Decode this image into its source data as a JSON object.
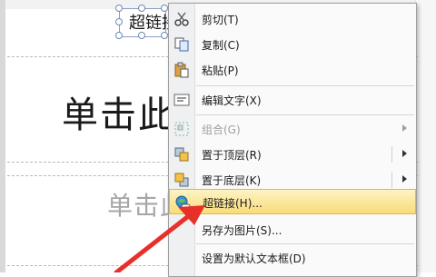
{
  "slide": {
    "hyperlink_textbox": "超链接",
    "title_placeholder": "单击此",
    "subtitle_placeholder": "单击此"
  },
  "context_menu": {
    "items": [
      {
        "label": "剪切(T)",
        "icon": "scissors-icon",
        "disabled": false,
        "submenu": false
      },
      {
        "label": "复制(C)",
        "icon": "copy-icon",
        "disabled": false,
        "submenu": false
      },
      {
        "label": "粘贴(P)",
        "icon": "paste-icon",
        "disabled": false,
        "submenu": false
      },
      {
        "label": "编辑文字(X)",
        "icon": "edit-text-icon",
        "disabled": false,
        "submenu": false
      },
      {
        "label": "组合(G)",
        "icon": "group-icon",
        "disabled": true,
        "submenu": true
      },
      {
        "label": "置于顶层(R)",
        "icon": "bring-to-front-icon",
        "disabled": false,
        "submenu": true
      },
      {
        "label": "置于底层(K)",
        "icon": "send-to-back-icon",
        "disabled": false,
        "submenu": true
      },
      {
        "label": "超链接(H)...",
        "icon": "hyperlink-globe-icon",
        "disabled": false,
        "submenu": false,
        "highlighted": true
      },
      {
        "label": "另存为图片(S)...",
        "icon": "",
        "disabled": false,
        "submenu": false
      },
      {
        "label": "设置为默认文本框(D)",
        "icon": "",
        "disabled": false,
        "submenu": false
      }
    ]
  },
  "colors": {
    "highlight": "#f8dc7a",
    "annotation_arrow": "#e8302a"
  }
}
